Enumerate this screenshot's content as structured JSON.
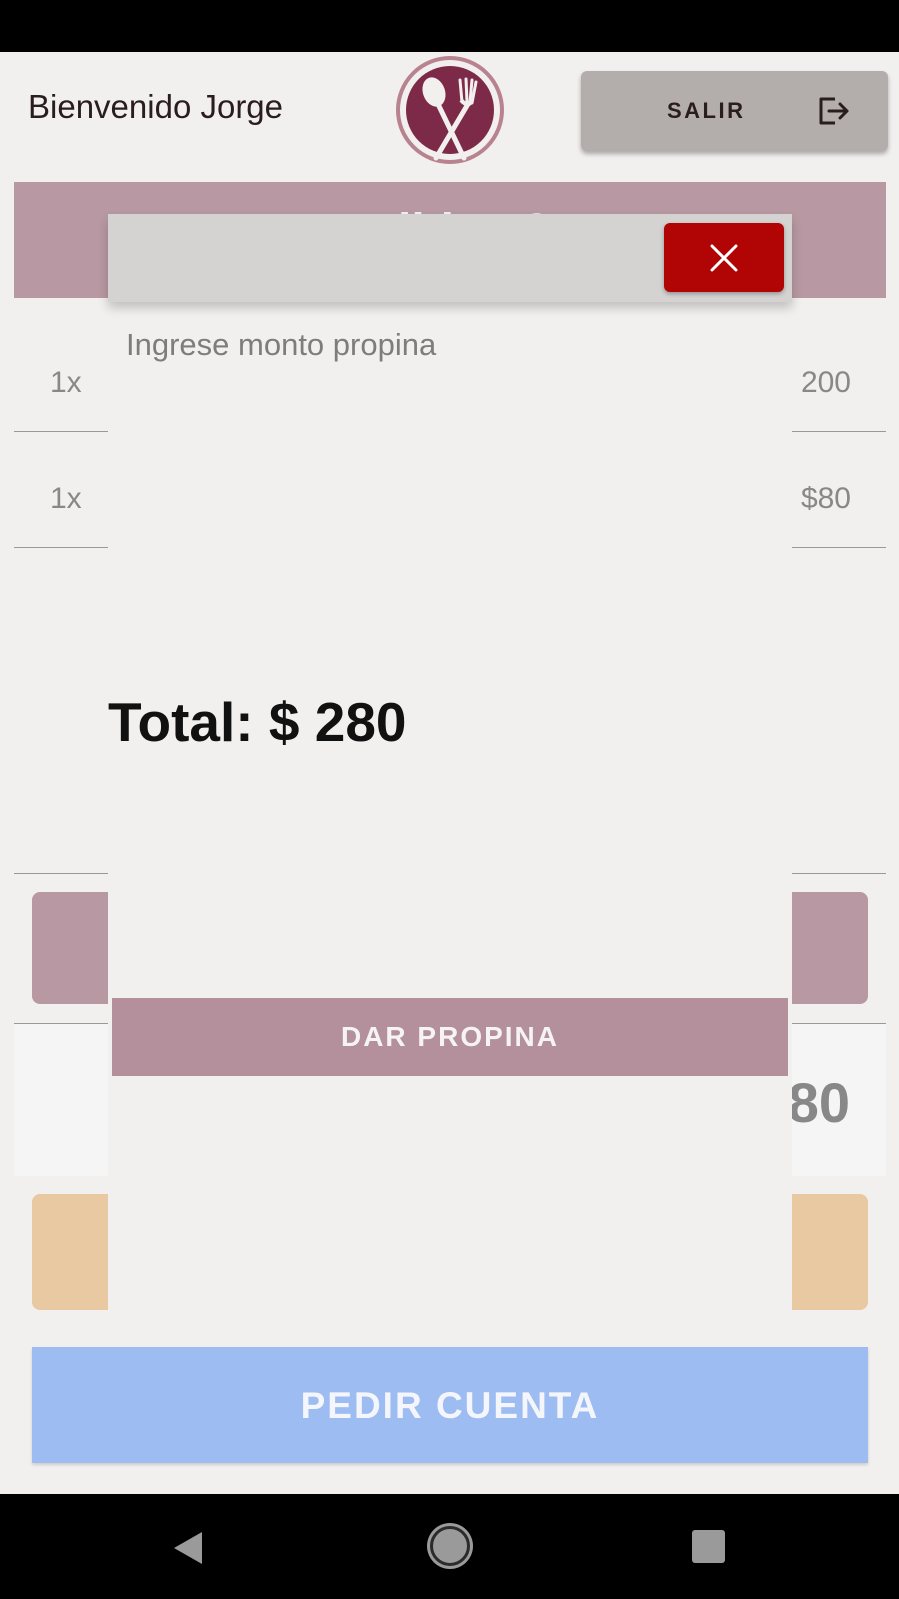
{
  "header": {
    "welcome_text": "Bienvenido Jorge",
    "logout_label": "SALIR",
    "logo_icon": "spoon-fork-logo"
  },
  "order": {
    "banner_title": "Pedido #25",
    "items": [
      {
        "qty": "1x",
        "price": "200"
      },
      {
        "qty": "1x",
        "price": "$80"
      }
    ],
    "total_value": "280",
    "request_bill_label": "PEDIR CUENTA"
  },
  "dialog": {
    "close_icon": "close-icon",
    "tip_placeholder": "Ingrese monto propina",
    "total_text": "Total: $ 280",
    "tip_button_label": "DAR PROPINA"
  },
  "colors": {
    "brand": "#7d2a49",
    "banner": "#b899a3",
    "tip_button": "#b3909c",
    "close_button": "#b10404",
    "request_bill": "#9dbdf2",
    "orange_button": "#e9c9a1"
  }
}
